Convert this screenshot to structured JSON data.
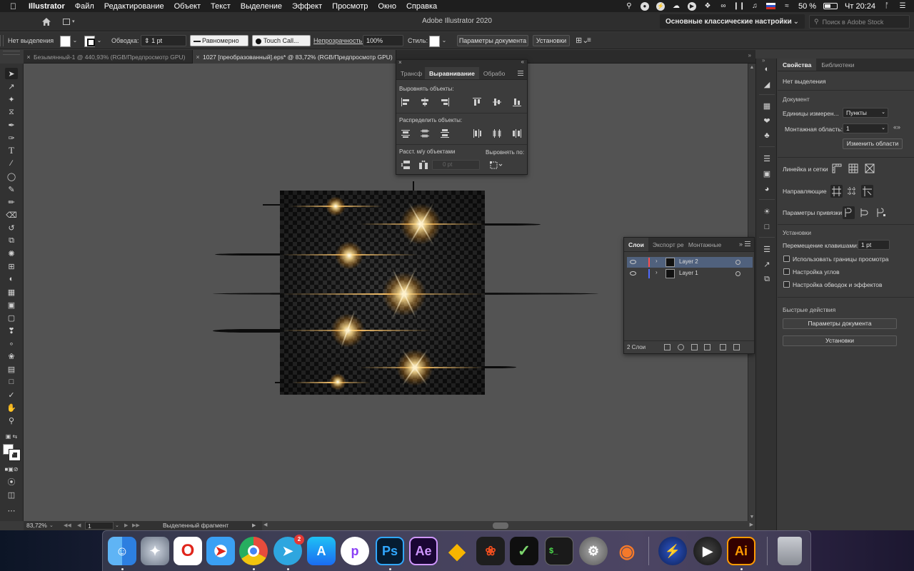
{
  "menubar": {
    "app_name": "Illustrator",
    "items": [
      "Файл",
      "Редактирование",
      "Объект",
      "Текст",
      "Выделение",
      "Эффект",
      "Просмотр",
      "Окно",
      "Справка"
    ],
    "battery": "50 %",
    "clock": "Чт 20:24"
  },
  "appbar": {
    "title": "Adobe Illustrator 2020",
    "workspace": "Основные классические настройки",
    "stock_placeholder": "Поиск в Adobe Stock"
  },
  "controlbar": {
    "selection": "Нет выделения",
    "stroke_label": "Обводка:",
    "stroke_value": "1 pt",
    "stroke_profile": "Равномерно",
    "brush": "Touch Call...",
    "opacity_label": "Непрозрачность:",
    "opacity_value": "100%",
    "style_label": "Стиль:",
    "doc_settings": "Параметры документа",
    "prefs": "Установки"
  },
  "tabs": [
    {
      "label": "Безымянный-1 @ 440,93% (RGB/Предпросмотр GPU)"
    },
    {
      "label": "1027 [преобразованный].eps* @ 83,72% (RGB/Предпросмотр GPU)"
    }
  ],
  "align_panel": {
    "tabs": [
      "Трансф",
      "Выравнивание",
      "Обрабо"
    ],
    "align_objects": "Выровнять объекты:",
    "distribute_objects": "Распределить объекты:",
    "spacing": "Расст. м/у объектами",
    "align_to": "Выровнять по:",
    "spacing_value": "0 pt"
  },
  "layers_panel": {
    "tabs": [
      "Слои",
      "Экспорт ре",
      "Монтажные"
    ],
    "layers": [
      {
        "name": "Layer 2",
        "color": "#ff4d4d",
        "selected": true
      },
      {
        "name": "Layer 1",
        "color": "#4f6bff",
        "selected": false
      }
    ],
    "count": "2 Слои"
  },
  "properties": {
    "tabs": [
      "Свойства",
      "Библиотеки"
    ],
    "no_selection": "Нет выделения",
    "document_head": "Документ",
    "units_label": "Единицы измерен...",
    "units_value": "Пункты",
    "artboard_label": "Монтажная область:",
    "artboard_value": "1",
    "edit_artboards": "Изменить области",
    "rulers_grids": "Линейка и сетки",
    "guides": "Направляющие",
    "snap": "Параметры привязки",
    "prefs_head": "Установки",
    "key_increment_label": "Перемещение клавишами:",
    "key_increment_value": "1 pt",
    "chk_preview_bounds": "Использовать границы просмотра",
    "chk_corners": "Настройка углов",
    "chk_strokes": "Настройка обводок и эффектов",
    "quick_actions": "Быстрые действия",
    "btn_doc_settings": "Параметры документа",
    "btn_prefs": "Установки"
  },
  "statusbar": {
    "zoom": "83,72%",
    "artboard": "1",
    "info": "Выделенный фрагмент"
  },
  "dock": {
    "telegram_badge": "2",
    "ps_label": "Ps",
    "ae_label": "Ae",
    "ai_label": "Ai"
  }
}
